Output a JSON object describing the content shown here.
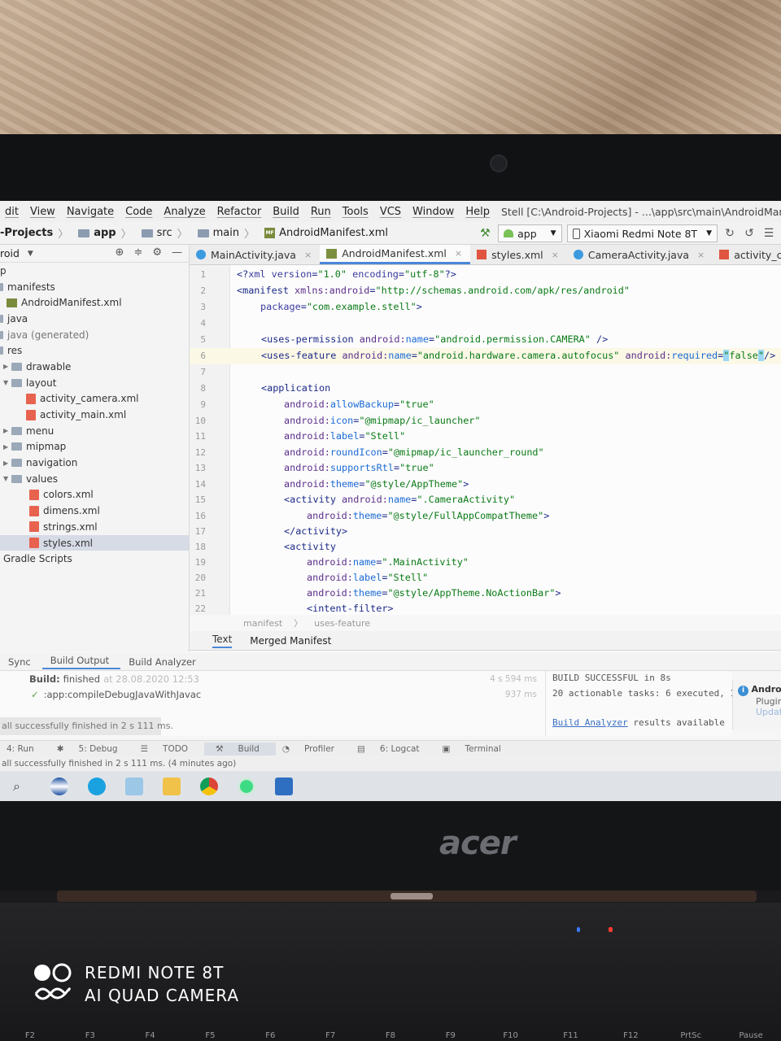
{
  "menubar": {
    "items": [
      "dit",
      "View",
      "Navigate",
      "Code",
      "Analyze",
      "Refactor",
      "Build",
      "Run",
      "Tools",
      "VCS",
      "Window",
      "Help"
    ],
    "title": "Stell [C:\\Android-Projects] - ...\\app\\src\\main\\AndroidManifest.xml [app] - Android S"
  },
  "navbar": {
    "crumbs": [
      "-Projects",
      "app",
      "src",
      "main",
      "AndroidManifest.xml"
    ],
    "run_config": "app",
    "device": "Xiaomi Redmi Note 8T"
  },
  "project": {
    "view": "roid",
    "items": [
      {
        "label": "p"
      },
      {
        "label": "manifests"
      },
      {
        "label": "AndroidManifest.xml"
      },
      {
        "label": "java"
      },
      {
        "label": "java (generated)"
      },
      {
        "label": "res"
      },
      {
        "label": "drawable"
      },
      {
        "label": "layout"
      },
      {
        "label": "activity_camera.xml"
      },
      {
        "label": "activity_main.xml"
      },
      {
        "label": "menu"
      },
      {
        "label": "mipmap"
      },
      {
        "label": "navigation"
      },
      {
        "label": "values"
      },
      {
        "label": "colors.xml"
      },
      {
        "label": "dimens.xml"
      },
      {
        "label": "strings.xml"
      },
      {
        "label": "styles.xml"
      },
      {
        "label": "Gradle Scripts"
      }
    ]
  },
  "tabs": [
    "MainActivity.java",
    "AndroidManifest.xml",
    "styles.xml",
    "CameraActivity.java",
    "activity_camera.xml"
  ],
  "editor": {
    "line_numbers": [
      "1",
      "2",
      "3",
      "4",
      "5",
      "6",
      "7",
      "8",
      "9",
      "10",
      "11",
      "12",
      "13",
      "14",
      "15",
      "16",
      "17",
      "18",
      "19",
      "20",
      "21",
      "22"
    ],
    "breadcrumb": [
      "manifest",
      "uses-feature"
    ],
    "bottom_tabs": [
      "Text",
      "Merged Manifest"
    ]
  },
  "build": {
    "tabs": [
      "Sync",
      "Build Output",
      "Build Analyzer"
    ],
    "tree": [
      {
        "label": "Build:",
        "status": "finished",
        "date": "at 28.08.2020 12:53",
        "time": "4 s 594 ms"
      },
      {
        "label": ":app:compileDebugJavaWithJavac",
        "time": "937 ms"
      }
    ],
    "output": [
      "BUILD SUCCESSFUL in 8s",
      "20 actionable tasks: 6 executed, 1",
      "results available"
    ],
    "output_link": "Build Analyzer",
    "balloon": "all successfully finished in 2 s 111 ms.",
    "notify": [
      "Andro",
      "Plugin",
      "Updat"
    ]
  },
  "bottom_tools": [
    "4: Run",
    "5: Debug",
    "TODO",
    "Build",
    "Profiler",
    "6: Logcat",
    "Terminal"
  ],
  "status": "all successfully finished in 2 s 111 ms. (4 minutes ago)",
  "watermark": {
    "line1": "REDMI NOTE 8T",
    "line2": "AI QUAD CAMERA"
  },
  "brand": "acer",
  "fkeys": [
    "F2",
    "F3",
    "F4",
    "F5",
    "F6",
    "F7",
    "F8",
    "F9",
    "F10",
    "F11",
    "F12",
    "PrtSc",
    "Pause"
  ]
}
